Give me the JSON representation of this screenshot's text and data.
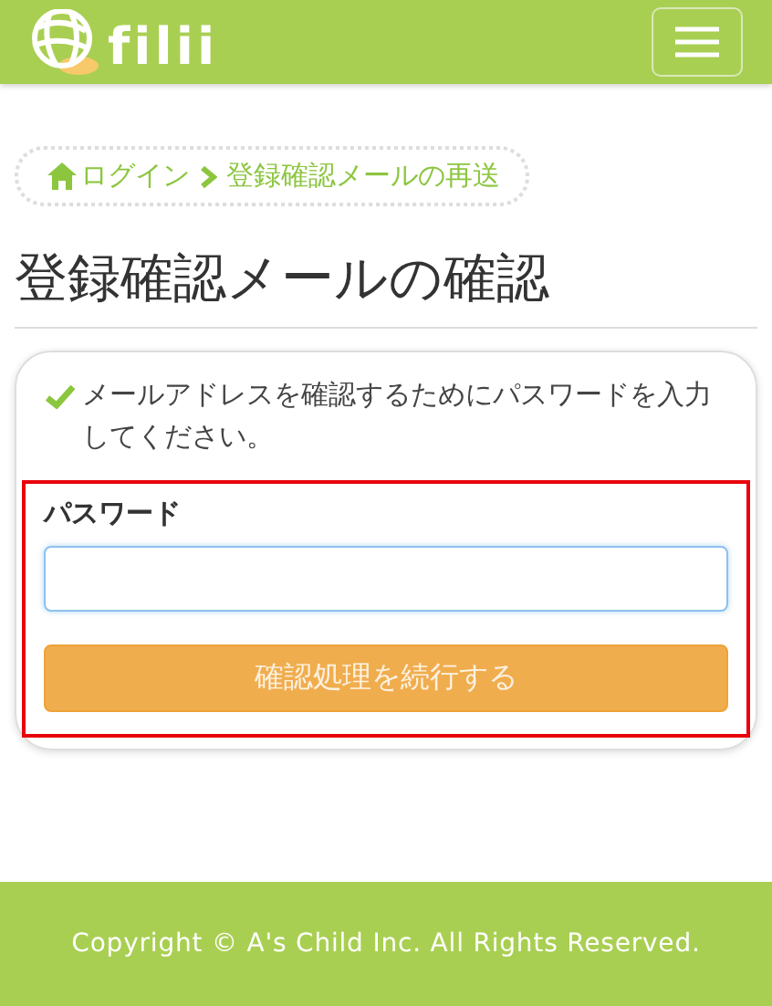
{
  "header": {
    "logo_text": "filii"
  },
  "breadcrumb": [
    {
      "label": "ログイン",
      "kind": "home"
    },
    {
      "label": "登録確認メールの再送",
      "kind": "current"
    }
  ],
  "page_title": "登録確認メールの確認",
  "card": {
    "message": "メールアドレスを確認するためにパスワードを入力してください。",
    "highlighted": true,
    "field": {
      "label": "パスワード",
      "focused": true
    },
    "submit_button": "確認処理を続行する"
  },
  "footer": "Copyright © A's Child Inc. All Rights Reserved."
}
